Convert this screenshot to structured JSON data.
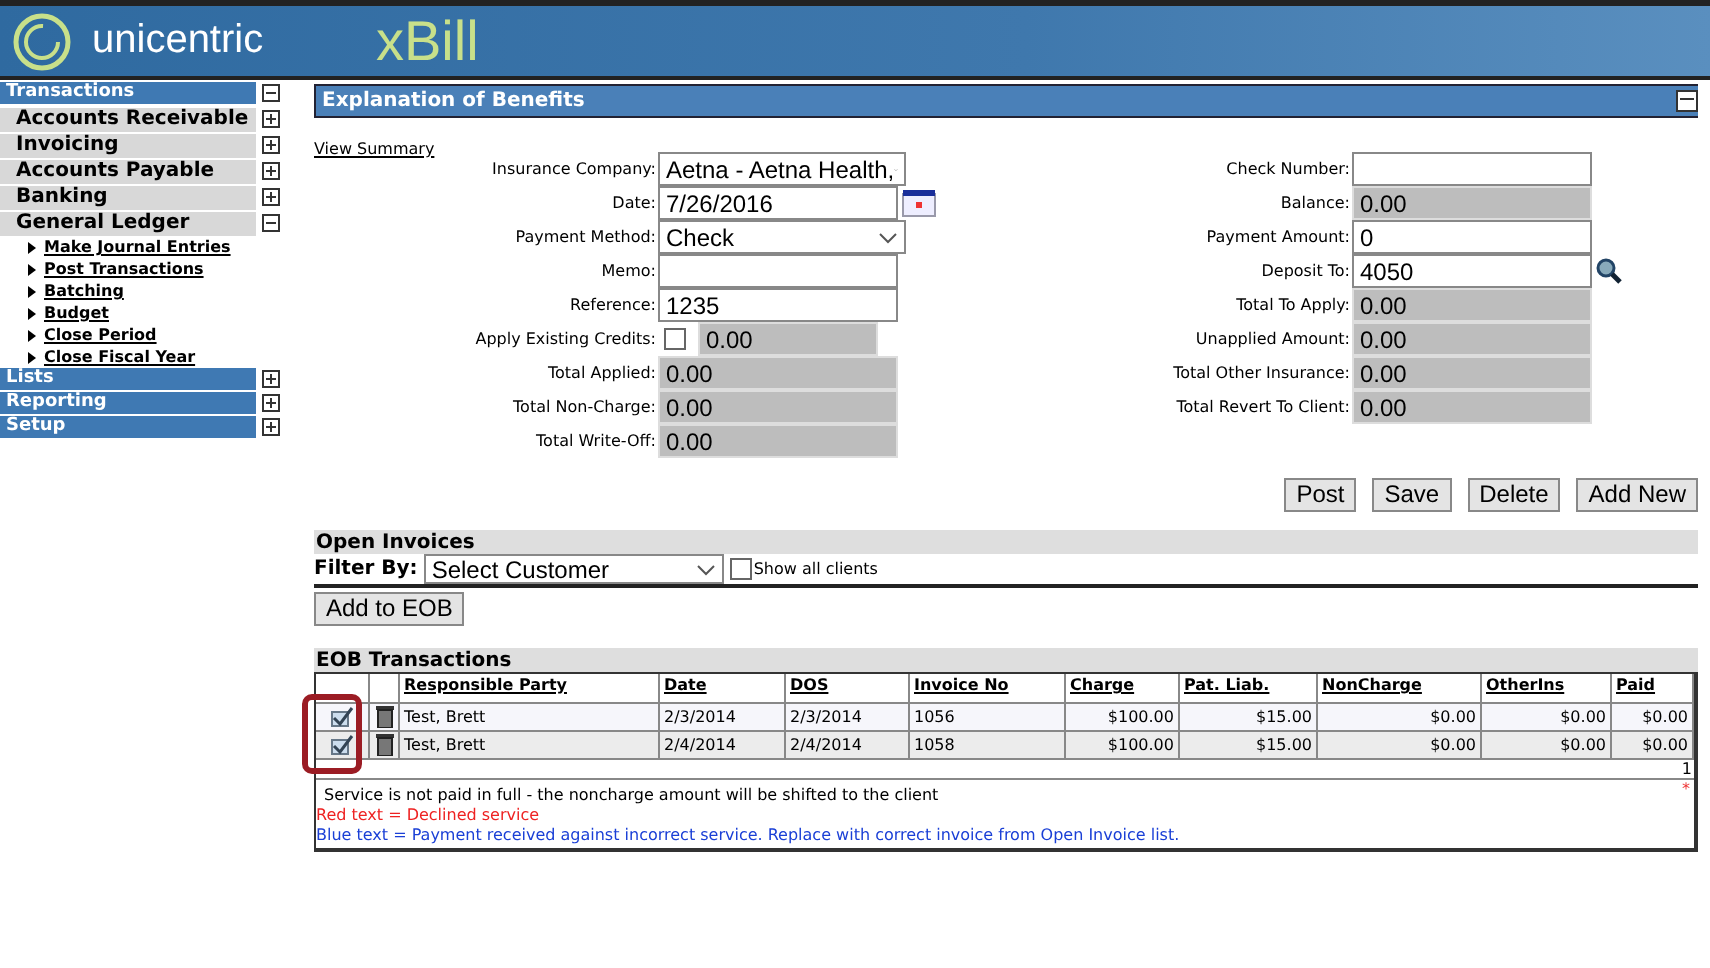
{
  "header": {
    "brand": "unicentric",
    "product": "xBill"
  },
  "sidebar": {
    "sections": [
      {
        "label": "Transactions",
        "expanded": true,
        "groups": [
          {
            "label": "Accounts Receivable",
            "expanded": false
          },
          {
            "label": "Invoicing",
            "expanded": false
          },
          {
            "label": "Accounts Payable",
            "expanded": false
          },
          {
            "label": "Banking",
            "expanded": false
          },
          {
            "label": "General Ledger",
            "expanded": true,
            "children": [
              {
                "label": "Make Journal Entries"
              },
              {
                "label": "Post Transactions"
              },
              {
                "label": "Batching"
              },
              {
                "label": "Budget"
              },
              {
                "label": "Close Period"
              },
              {
                "label": "Close Fiscal Year"
              }
            ]
          }
        ]
      },
      {
        "label": "Lists",
        "expanded": false
      },
      {
        "label": "Reporting",
        "expanded": false
      },
      {
        "label": "Setup",
        "expanded": false
      }
    ]
  },
  "panel": {
    "title": "Explanation of Benefits",
    "expanded": true,
    "link": "View Summary"
  },
  "form_left": [
    {
      "kind": "select",
      "label": "Insurance Company:",
      "value": "Aetna - Aetna Health,"
    },
    {
      "kind": "date",
      "label": "Date:",
      "value": "7/26/2016"
    },
    {
      "kind": "select",
      "label": "Payment Method:",
      "value": "Check"
    },
    {
      "kind": "input",
      "label": "Memo:"
    },
    {
      "kind": "input",
      "label": "Reference:",
      "value": "1235"
    },
    {
      "kind": "checkbox",
      "label": "Apply Existing Credits:",
      "checked": false,
      "value": "0.00"
    },
    {
      "kind": "readonly",
      "label": "Total Applied:",
      "value": "0.00"
    },
    {
      "kind": "readonly",
      "label": "Total Non-Charge:",
      "value": "0.00"
    },
    {
      "kind": "readonly",
      "label": "Total Write-Off:",
      "value": "0.00"
    }
  ],
  "form_right": [
    {
      "kind": "input",
      "label": "Check Number:"
    },
    {
      "kind": "readonly",
      "label": "Balance:",
      "value": "0.00"
    },
    {
      "kind": "input",
      "label": "Payment Amount:",
      "value": "0"
    },
    {
      "kind": "lookup",
      "label": "Deposit To:",
      "value": "4050"
    },
    {
      "kind": "readonly",
      "label": "Total To Apply:",
      "value": "0.00"
    },
    {
      "kind": "readonly",
      "label": "Unapplied Amount:",
      "value": "0.00"
    },
    {
      "kind": "readonly",
      "label": "Total Other Insurance:",
      "value": "0.00"
    },
    {
      "kind": "readonly",
      "label": "Total Revert To Client:",
      "value": "0.00"
    }
  ],
  "actions": [
    "Post",
    "Save",
    "Delete",
    "Add New"
  ],
  "open_invoices": {
    "title": "Open Invoices",
    "filter_label": "Filter By:",
    "filter_value": "Select Customer",
    "show_all_label": "Show all clients",
    "show_all_checked": false,
    "add_button": "Add to EOB"
  },
  "eob": {
    "title": "EOB Transactions",
    "columns": [
      "Responsible Party",
      "Date",
      "DOS",
      "Invoice No",
      "Charge",
      "Pat. Liab.",
      "NonCharge",
      "OtherIns",
      "Paid"
    ],
    "rows": [
      [
        "Test, Brett",
        "2/3/2014",
        "2/3/2014",
        "1056",
        "$100.00",
        "$15.00",
        "$0.00",
        "$0.00",
        "$0.00"
      ],
      [
        "Test, Brett",
        "2/4/2014",
        "2/4/2014",
        "1058",
        "$100.00",
        "$15.00",
        "$0.00",
        "$0.00",
        "$0.00"
      ]
    ],
    "page": "1",
    "mark": "*",
    "notes": [
      {
        "kind": "plain",
        "text": "Service is not paid in full - the noncharge amount will be shifted to the client"
      },
      {
        "kind": "red",
        "text": "Red text = Declined service"
      },
      {
        "kind": "blue",
        "text": "Blue text = Payment received against incorrect service. Replace with correct invoice from Open Invoice list."
      }
    ]
  }
}
